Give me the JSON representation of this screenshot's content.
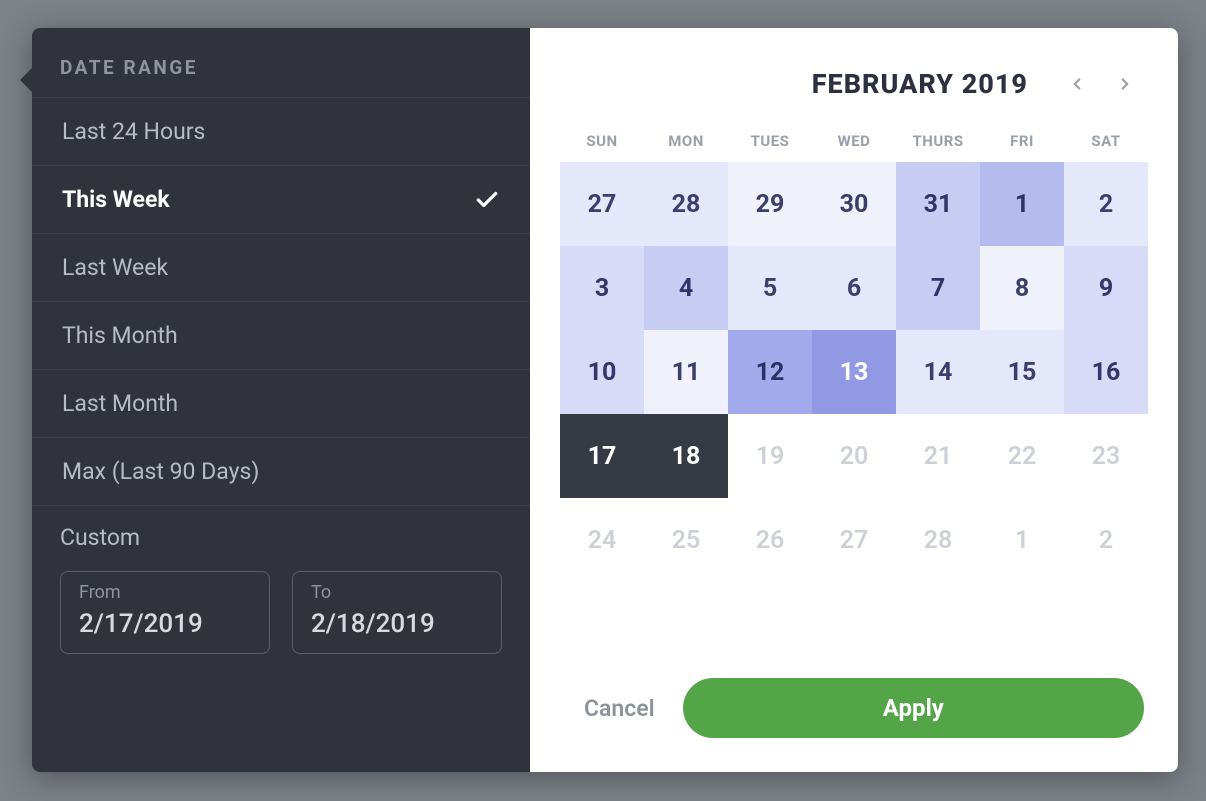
{
  "title": "DATE RANGE",
  "ranges": [
    {
      "label": "Last 24 Hours",
      "selected": false
    },
    {
      "label": "This Week",
      "selected": true
    },
    {
      "label": "Last Week",
      "selected": false
    },
    {
      "label": "This Month",
      "selected": false
    },
    {
      "label": "Last Month",
      "selected": false
    },
    {
      "label": "Max (Last 90 Days)",
      "selected": false
    }
  ],
  "custom": {
    "label": "Custom",
    "from_label": "From",
    "to_label": "To",
    "from_value": "2/17/2019",
    "to_value": "2/18/2019"
  },
  "calendar": {
    "month_label": "FEBRUARY 2019",
    "dow": [
      "SUN",
      "MON",
      "TUES",
      "WED",
      "THURS",
      "FRI",
      "SAT"
    ],
    "cells": [
      {
        "n": "27",
        "cls": "h1 day-out"
      },
      {
        "n": "28",
        "cls": "h1 day-out"
      },
      {
        "n": "29",
        "cls": "h0 day-out"
      },
      {
        "n": "30",
        "cls": "h0 day-out"
      },
      {
        "n": "31",
        "cls": "h3 day-out"
      },
      {
        "n": "1",
        "cls": "h4"
      },
      {
        "n": "2",
        "cls": "h1"
      },
      {
        "n": "3",
        "cls": "h2"
      },
      {
        "n": "4",
        "cls": "h3"
      },
      {
        "n": "5",
        "cls": "h1"
      },
      {
        "n": "6",
        "cls": "h1"
      },
      {
        "n": "7",
        "cls": "h3"
      },
      {
        "n": "8",
        "cls": "h0"
      },
      {
        "n": "9",
        "cls": "h2"
      },
      {
        "n": "10",
        "cls": "h2"
      },
      {
        "n": "11",
        "cls": "h0"
      },
      {
        "n": "12",
        "cls": "h5"
      },
      {
        "n": "13",
        "cls": "h6"
      },
      {
        "n": "14",
        "cls": "h1"
      },
      {
        "n": "15",
        "cls": "h1"
      },
      {
        "n": "16",
        "cls": "h2"
      },
      {
        "n": "17",
        "cls": "day-sel"
      },
      {
        "n": "18",
        "cls": "day-sel"
      },
      {
        "n": "19",
        "cls": "day-future"
      },
      {
        "n": "20",
        "cls": "day-future"
      },
      {
        "n": "21",
        "cls": "day-future"
      },
      {
        "n": "22",
        "cls": "day-future"
      },
      {
        "n": "23",
        "cls": "day-future"
      },
      {
        "n": "24",
        "cls": "day-future"
      },
      {
        "n": "25",
        "cls": "day-future"
      },
      {
        "n": "26",
        "cls": "day-future"
      },
      {
        "n": "27",
        "cls": "day-future"
      },
      {
        "n": "28",
        "cls": "day-future"
      },
      {
        "n": "1",
        "cls": "day-future"
      },
      {
        "n": "2",
        "cls": "day-future"
      }
    ]
  },
  "footer": {
    "cancel": "Cancel",
    "apply": "Apply"
  },
  "icons": {
    "check": "check-icon",
    "prev": "chevron-left-icon",
    "next": "chevron-right-icon"
  }
}
